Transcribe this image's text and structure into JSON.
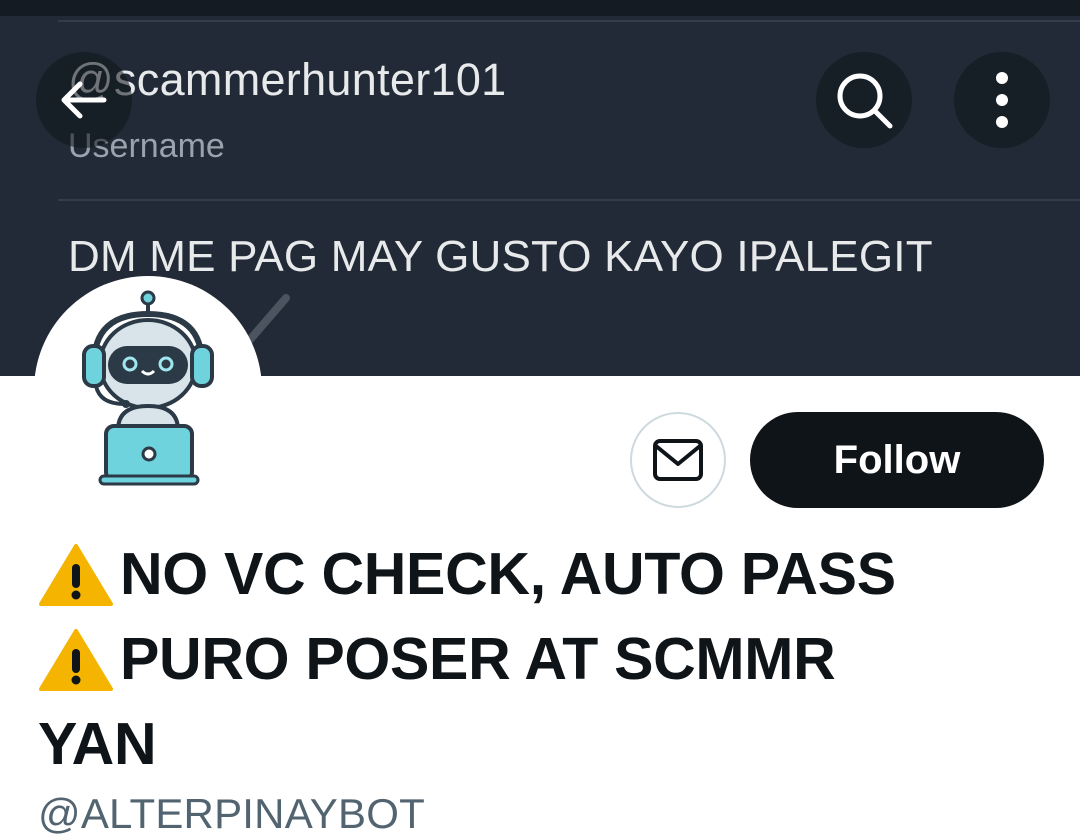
{
  "banner": {
    "username": "@scammerhunter101",
    "username_label": "Username",
    "bio": "DM ME PAG MAY GUSTO KAYO IPALEGIT",
    "background_color": "#212a36"
  },
  "header": {
    "back_icon": "arrow-left-icon",
    "search_icon": "search-icon",
    "more_icon": "more-vertical-icon"
  },
  "profile": {
    "avatar_icon": "robot-avatar-icon",
    "message_icon": "envelope-icon",
    "follow_label": "Follow",
    "name_lines": [
      "NO VC CHECK, AUTO PASS",
      "PURO POSER AT SCMMR",
      "YAN"
    ],
    "warning_icon": "warning-icon",
    "handle": "@ALTERPINAYBOT"
  },
  "colors": {
    "follow_bg": "#0f1419",
    "handle": "#536471",
    "warning": "#f4b400"
  }
}
